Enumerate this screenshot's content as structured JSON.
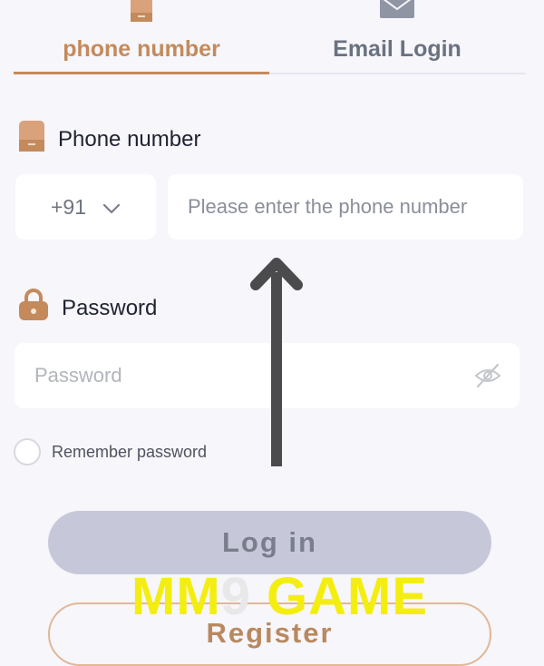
{
  "tabs": [
    {
      "label": "phone number",
      "icon": "phone-icon",
      "active": true
    },
    {
      "label": "Email Login",
      "icon": "envelope-icon",
      "active": false
    }
  ],
  "phone_section": {
    "label": "Phone number",
    "icon": "phone-icon",
    "country_code": "+91",
    "placeholder": "Please enter the phone number"
  },
  "password_section": {
    "label": "Password",
    "icon": "lock-icon",
    "placeholder": "Password"
  },
  "remember": {
    "label": "Remember password"
  },
  "buttons": {
    "login": "Log in",
    "register": "Register"
  },
  "watermark": {
    "text_a": "MM",
    "text_nine": "9",
    "text_b": " GAME"
  },
  "colors": {
    "accent": "#c48a5b",
    "background": "#f6f6fb",
    "login_disabled": "#c6c8d9",
    "watermark": "#f4ee10"
  }
}
